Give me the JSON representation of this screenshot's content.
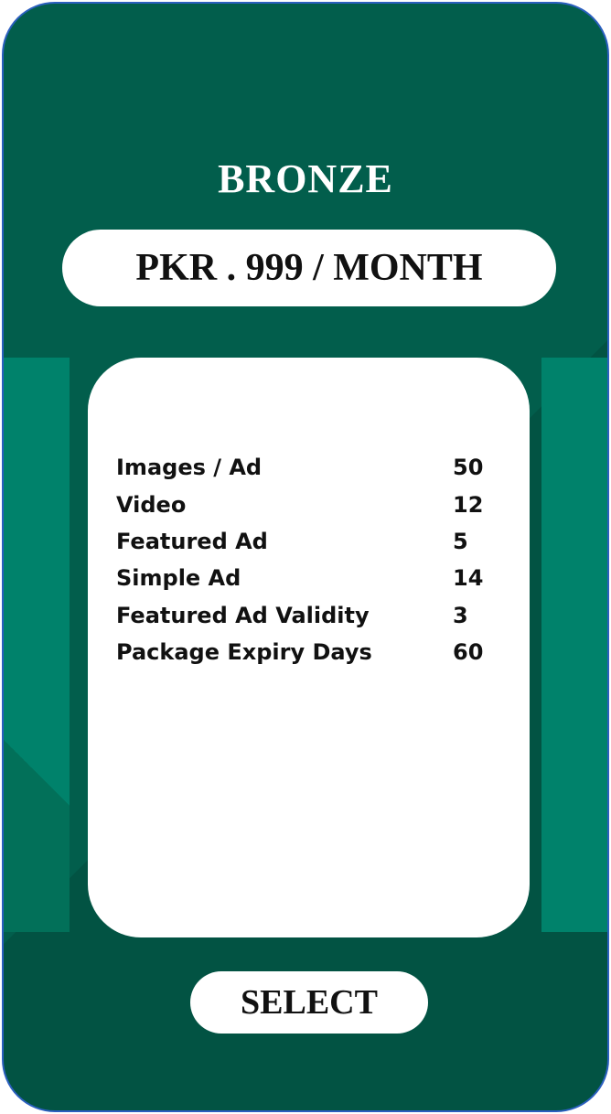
{
  "plan": {
    "name": "BRONZE",
    "price": "PKR . 999 / MONTH",
    "features": [
      {
        "label": "Images / Ad",
        "value": "50"
      },
      {
        "label": "Video",
        "value": "12"
      },
      {
        "label": "Featured Ad",
        "value": "5"
      },
      {
        "label": "Simple Ad",
        "value": "14"
      },
      {
        "label": "Featured Ad Validity",
        "value": "3"
      },
      {
        "label": "Package Expiry Days",
        "value": "60"
      }
    ],
    "select_label": "SELECT"
  },
  "colors": {
    "card_background": "#025e4c",
    "accent_band": "#00826b",
    "border": "#2b5fbf",
    "surface": "#ffffff",
    "text": "#111111"
  }
}
